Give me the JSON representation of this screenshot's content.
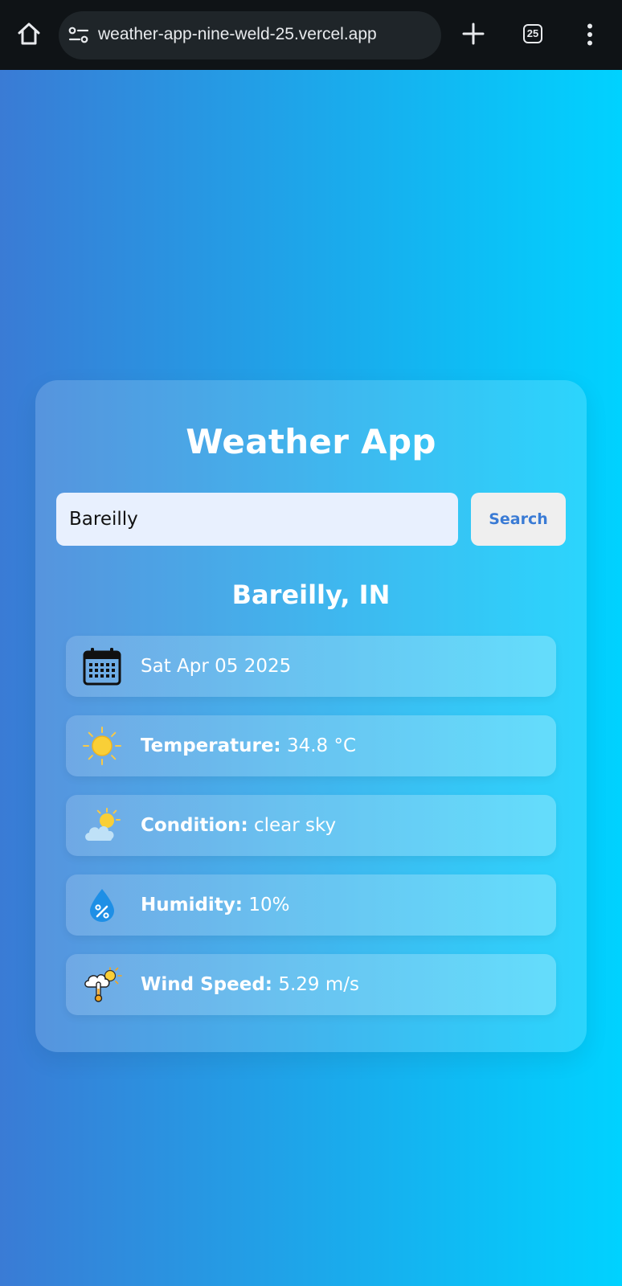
{
  "browser": {
    "url": "weather-app-nine-weld-25.vercel.app",
    "tab_count": "25"
  },
  "app": {
    "title": "Weather App",
    "search": {
      "value": "Bareilly",
      "button_label": "Search"
    },
    "location": "Bareilly, IN",
    "details": {
      "date": "Sat Apr 05 2025",
      "temperature_label": "Temperature:",
      "temperature_value": "34.8 °C",
      "condition_label": "Condition:",
      "condition_value": "clear sky",
      "humidity_label": "Humidity:",
      "humidity_value": "10%",
      "wind_label": "Wind Speed:",
      "wind_value": "5.29 m/s"
    }
  },
  "icons": {
    "home": "home-icon",
    "site_settings": "tune-icon",
    "new_tab": "plus-icon",
    "tabs": "tab-switcher-icon",
    "menu": "more-vert-icon",
    "date": "calendar-icon",
    "temperature": "sun-icon",
    "condition": "partly-cloudy-icon",
    "humidity": "humidity-drop-icon",
    "wind": "wind-thermometer-icon"
  },
  "colors": {
    "gradient_start": "#3a7bd5",
    "gradient_end": "#00d2ff",
    "browser_bar": "#0f1316",
    "search_button_text": "#3a7bd5"
  }
}
